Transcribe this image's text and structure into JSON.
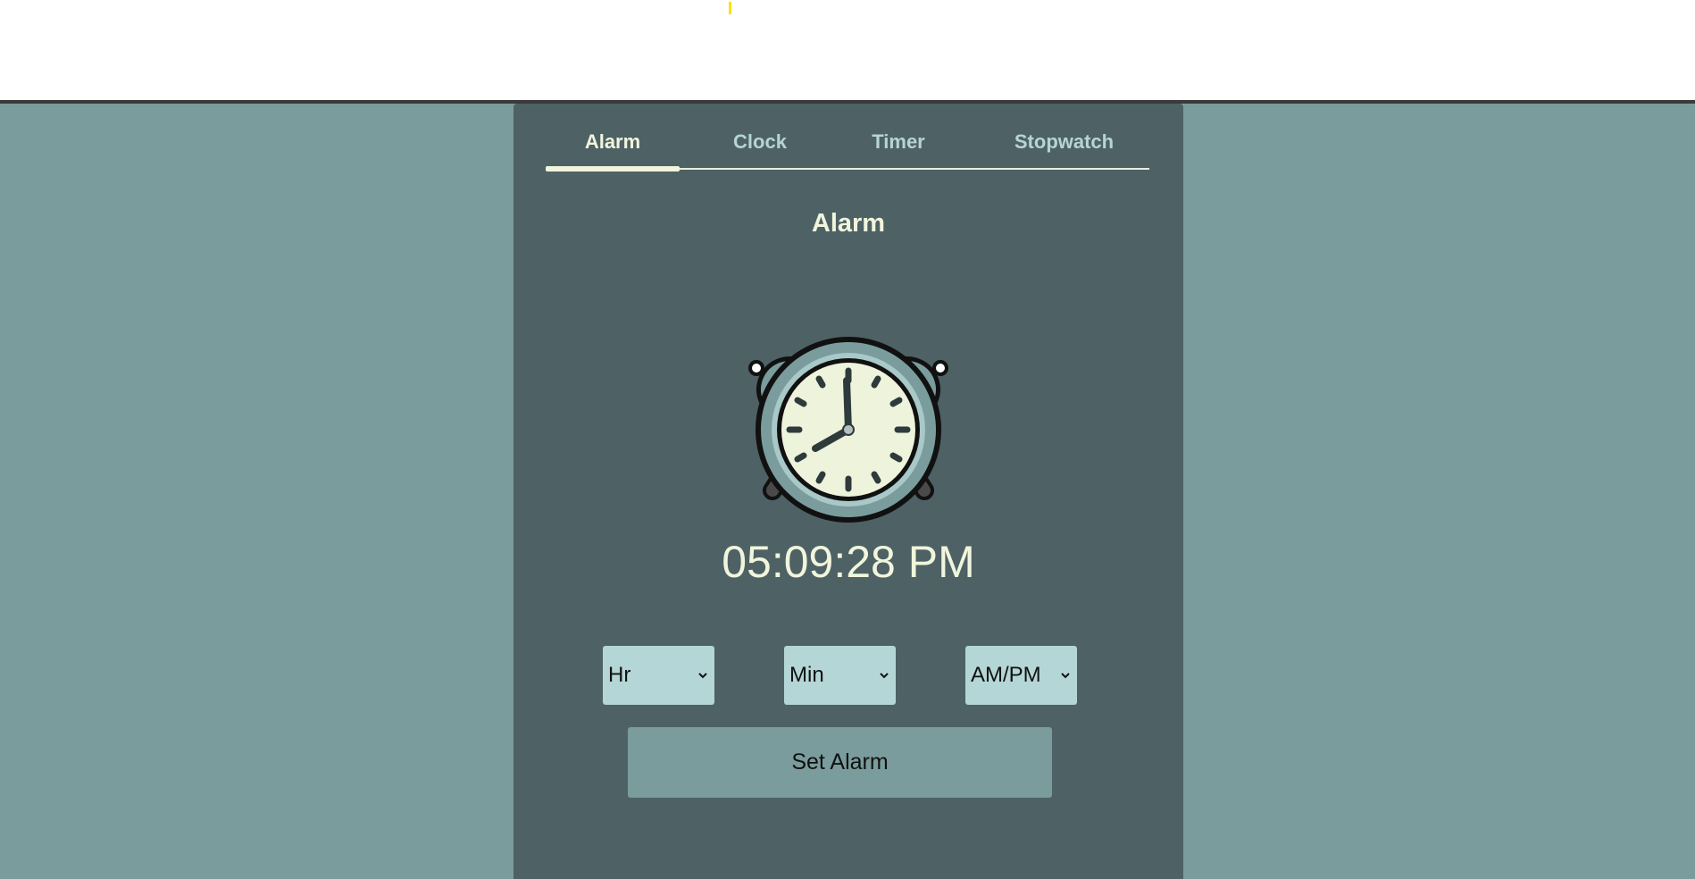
{
  "tabs": [
    {
      "label": "Alarm",
      "active": true
    },
    {
      "label": "Clock",
      "active": false
    },
    {
      "label": "Timer",
      "active": false
    },
    {
      "label": "Stopwatch",
      "active": false
    }
  ],
  "alarm": {
    "heading": "Alarm",
    "icon": "alarm-clock-icon",
    "current_time": "05:09:28 PM",
    "hour_select": {
      "value": "Hr"
    },
    "minute_select": {
      "value": "Min"
    },
    "ampm_select": {
      "value": "AM/PM"
    },
    "set_button_label": "Set Alarm"
  },
  "colors": {
    "page_background": "#7a9c9c",
    "panel_background": "#4e6165",
    "text_light": "#f0f5dc",
    "tab_inactive": "#b6d4d4",
    "select_background": "#b4d6d6",
    "button_background": "#7a9c9c"
  }
}
